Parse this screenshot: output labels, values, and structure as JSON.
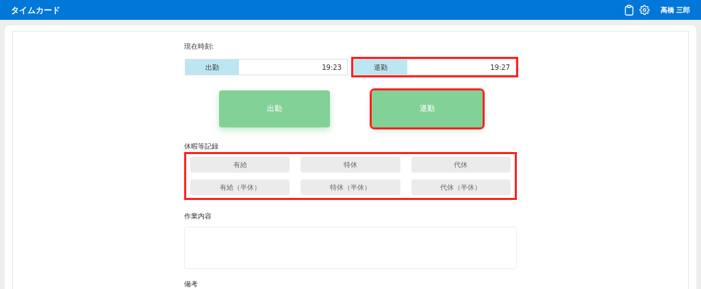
{
  "header": {
    "title": "タイムカード",
    "user": "高橋 三郎"
  },
  "current_time": {
    "label": "現在時刻:",
    "entries": [
      {
        "label": "出勤",
        "time": "19:23",
        "highlighted": false
      },
      {
        "label": "退勤",
        "time": "19:27",
        "highlighted": true
      }
    ]
  },
  "punch_buttons": [
    {
      "label": "出勤",
      "highlighted": false
    },
    {
      "label": "退勤",
      "highlighted": true
    }
  ],
  "leave_records": {
    "label": "休暇等記録",
    "highlighted": true,
    "options": [
      "有給",
      "特休",
      "代休",
      "有給（半休）",
      "特休（半休）",
      "代休（半休）"
    ]
  },
  "work_content": {
    "label": "作業内容"
  },
  "remarks": {
    "label": "備考"
  }
}
